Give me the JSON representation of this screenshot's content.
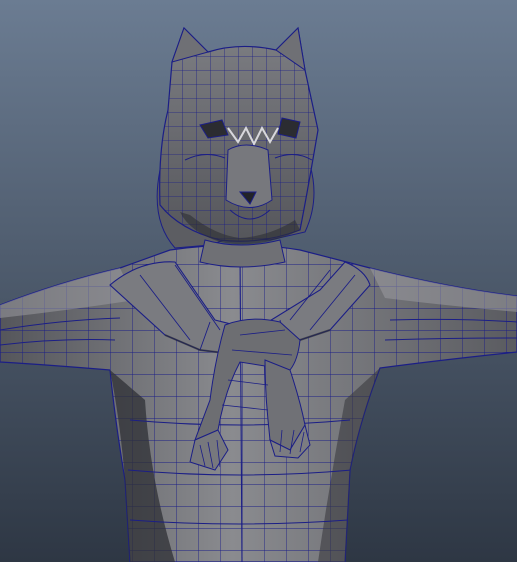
{
  "viewport": {
    "background_top": "#6b7c92",
    "background_bottom": "#2e3744",
    "mesh_fill_light": "#8a8b8f",
    "mesh_fill_mid": "#6d6e72",
    "mesh_fill_dark": "#3e3f44",
    "wire_color": "#1b1e86"
  },
  "model": {
    "parts": [
      "wolf-headdress",
      "torso",
      "left-arm",
      "right-arm",
      "pelt-sash",
      "hanging-paws"
    ]
  }
}
